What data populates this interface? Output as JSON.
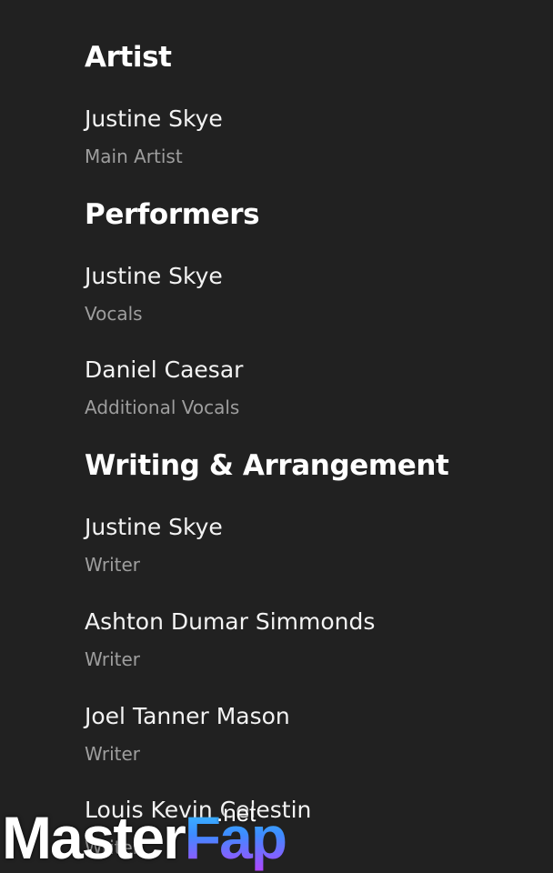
{
  "sections": [
    {
      "title": "Artist",
      "credits": [
        {
          "name": "Justine Skye",
          "role": "Main Artist"
        }
      ]
    },
    {
      "title": "Performers",
      "credits": [
        {
          "name": "Justine Skye",
          "role": "Vocals"
        },
        {
          "name": "Daniel Caesar",
          "role": "Additional Vocals"
        }
      ]
    },
    {
      "title": "Writing & Arrangement",
      "credits": [
        {
          "name": "Justine Skye",
          "role": "Writer"
        },
        {
          "name": "Ashton Dumar Simmonds",
          "role": "Writer"
        },
        {
          "name": "Joel Tanner Mason",
          "role": "Writer"
        },
        {
          "name": "Louis Kevin Celestin",
          "role": "Writer"
        }
      ]
    }
  ],
  "watermark": {
    "part1": "Master",
    "part2": "Fap",
    "suffix": ".net"
  }
}
